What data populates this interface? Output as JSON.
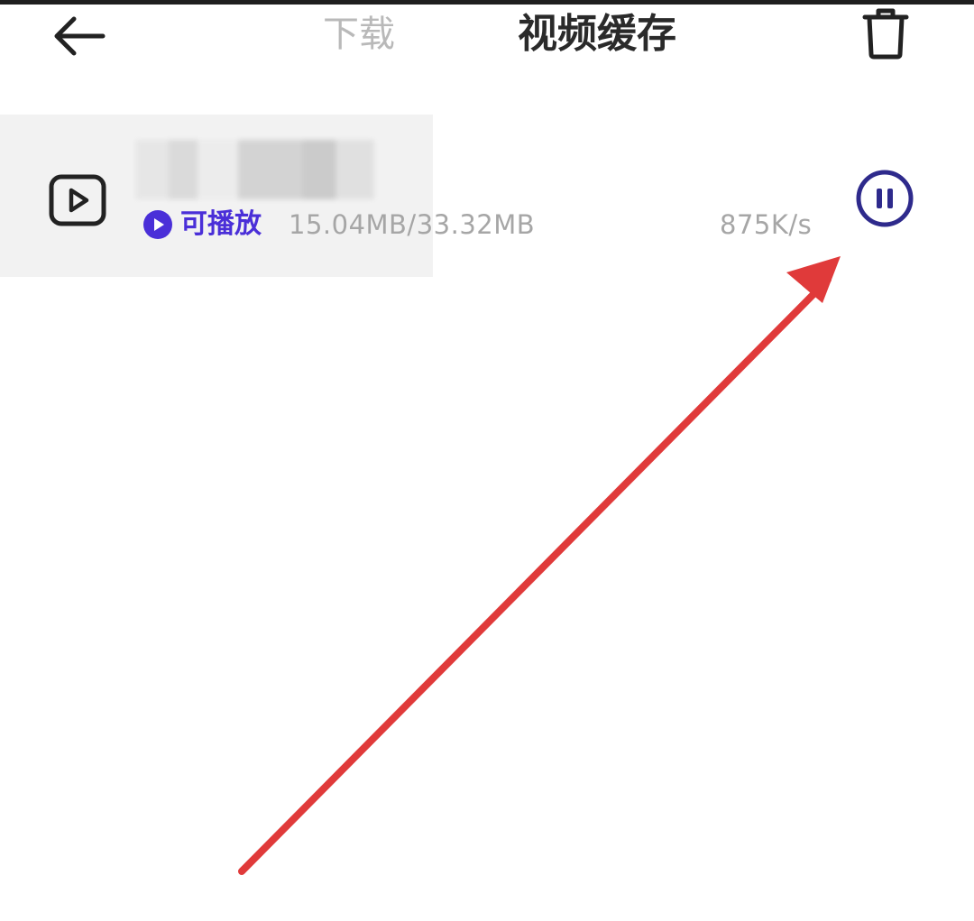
{
  "header": {
    "back_icon": "arrow-left-icon",
    "tabs": [
      {
        "label": "下载",
        "active": false
      },
      {
        "label": "视频缓存",
        "active": true
      }
    ],
    "delete_icon": "trash-icon"
  },
  "downloads": {
    "items": [
      {
        "title": "",
        "file_icon": "video-play-icon",
        "status_label": "可播放",
        "size": "15.04MB/33.32MB",
        "speed": "875K/s",
        "action_icon": "pause-icon"
      }
    ]
  },
  "colors": {
    "accent": "#4a2fd8",
    "pause_accent": "#2e2a8c",
    "annotation": "#e03a3a",
    "inactive_tab": "#b9b9b9",
    "active_tab": "#2a2a2a",
    "secondary_text": "#a6a6a6"
  }
}
